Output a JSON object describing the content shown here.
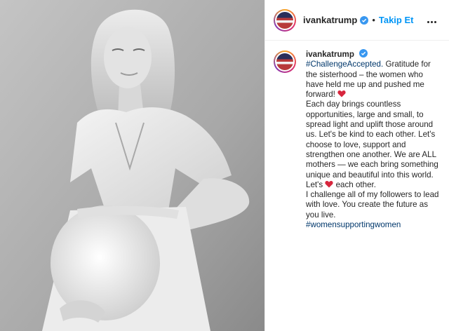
{
  "post": {
    "username": "ivankatrump",
    "follow_label": "Takip Et",
    "separator": "•",
    "verified_color": "#3897f0",
    "follow_color": "#0095f6",
    "hashtag_color": "#00376b",
    "caption": {
      "username": "ivankatrump",
      "hashtag_top": "#ChallengeAccepted.",
      "line_1": "Gratitude for the sisterhood – the women who have held me up and pushed me forward!",
      "line_2": "Each day brings countless opportunities, large and small, to spread light and uplift those around us. Let's be kind to each other. Let's choose to love, support and strengthen one another. We are ALL mothers — we each bring something unique and beautiful into this world.",
      "line_3_pre": "Let's",
      "line_3_post": "each other.",
      "line_4": "I challenge all of my followers to lead with love. You create the future as you live.",
      "hashtag_bottom": "#womensupportingwomen"
    },
    "icons": {
      "verified": "verified-badge-icon",
      "heart": "red-heart-emoji-icon",
      "more": "more-options-icon"
    }
  }
}
